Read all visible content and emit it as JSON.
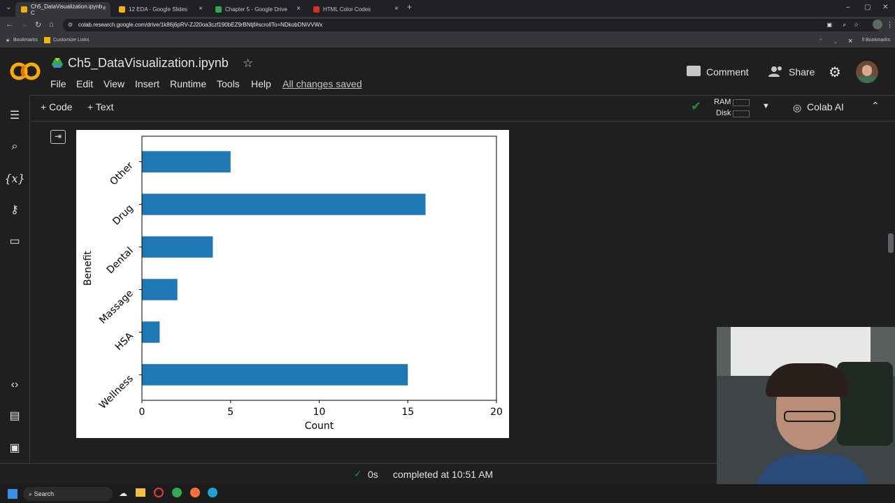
{
  "browser": {
    "tabs": [
      {
        "title": "Ch5_DataVisualization.ipynb - C",
        "active": true,
        "favicon_color": "#f9ab00"
      },
      {
        "title": "12 EDA - Google Slides",
        "active": false,
        "favicon_color": "#f4b400"
      },
      {
        "title": "Chapter 5 - Google Drive",
        "active": false,
        "favicon_color": "#34a853"
      },
      {
        "title": "HTML Color Codes",
        "active": false,
        "favicon_color": "#d93025"
      }
    ],
    "url": "colab.research.google.com/drive/1k86j6pRV-ZJ20oa3czf190bEZ9rBNtjf#scrollTo=NDkobDNiVVWx",
    "bookmarks": [
      "Bookmarks",
      "Customize Links"
    ],
    "bookmarks_right": "ll Bookmarks"
  },
  "colab": {
    "title": "Ch5_DataVisualization.ipynb",
    "menu": [
      "File",
      "Edit",
      "View",
      "Insert",
      "Runtime",
      "Tools",
      "Help"
    ],
    "save_status": "All changes saved",
    "comment_label": "Comment",
    "share_label": "Share",
    "toolbar": {
      "code_label": "Code",
      "text_label": "Text",
      "ram_label": "RAM",
      "disk_label": "Disk",
      "colab_ai_label": "Colab AI"
    }
  },
  "chart_data": {
    "type": "bar",
    "orientation": "horizontal",
    "categories": [
      "Wellness",
      "HSA",
      "Massage",
      "Dental",
      "Drug",
      "Other"
    ],
    "values": [
      15,
      1,
      2,
      4,
      16,
      5
    ],
    "xlabel": "Count",
    "ylabel": "Benefit",
    "xlim": [
      0,
      20
    ],
    "xticks": [
      "0",
      "5",
      "10",
      "15",
      "20"
    ],
    "bar_color": "#1f77b4",
    "grid": false
  },
  "status": {
    "time_label": "0s",
    "message": "completed at 10:51 AM"
  },
  "taskbar": {
    "search_label": "Search"
  }
}
